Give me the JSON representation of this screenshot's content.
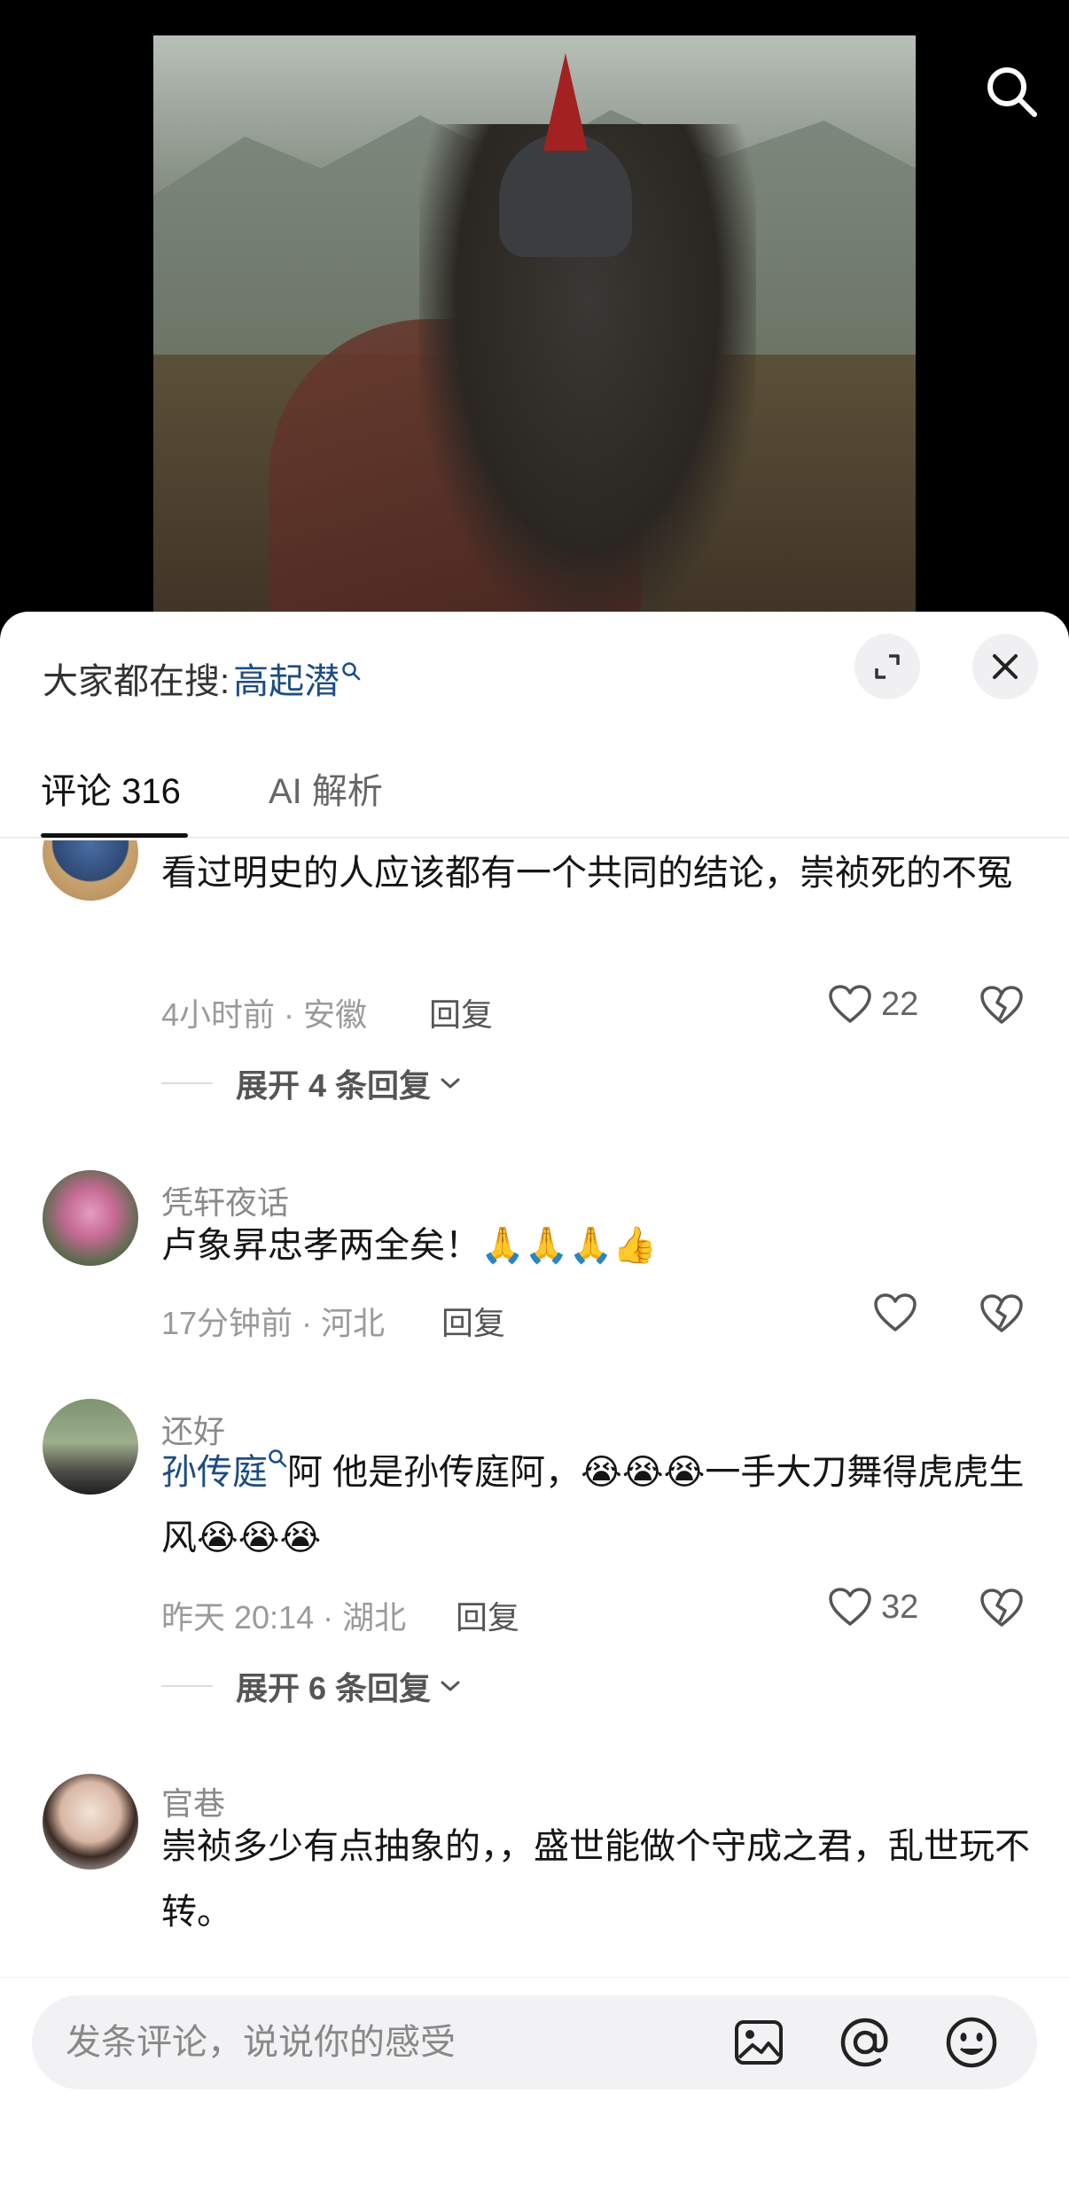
{
  "header": {
    "hot_search_prefix": "大家都在搜:",
    "hot_search_keyword": "高起潜"
  },
  "tabs": [
    {
      "label": "评论 316",
      "active": true
    },
    {
      "label": "AI 解析",
      "active": false
    }
  ],
  "comments": [
    {
      "user": "",
      "text": "看过明史的人应该都有一个共同的结论，崇祯死的不冤",
      "time": "4小时前 · 安徽",
      "reply_label": "回复",
      "likes": "22",
      "expand": "展开 4 条回复"
    },
    {
      "user": "凭轩夜话",
      "text": "卢象昇忠孝两全矣！🙏🙏🙏👍",
      "time": "17分钟前 · 河北",
      "reply_label": "回复",
      "likes": ""
    },
    {
      "user": "还好",
      "mention": "孙传庭",
      "text": "阿  他是孙传庭阿，😭😭😭一手大刀舞得虎虎生风😭😭😭",
      "time": "昨天 20:14 · 湖北",
      "reply_label": "回复",
      "likes": "32",
      "expand": "展开 6 条回复"
    },
    {
      "user": "官巷",
      "text": "崇祯多少有点抽象的，，盛世能做个守成之君，乱世玩不转。"
    }
  ],
  "composer": {
    "placeholder": "发条评论，说说你的感受"
  },
  "icons": {
    "search": "search-icon",
    "expand": "expand-icon",
    "close": "close-icon",
    "like": "heart-icon",
    "dislike": "broken-heart-icon",
    "image": "image-icon",
    "at": "at-icon",
    "emoji": "emoji-icon"
  }
}
